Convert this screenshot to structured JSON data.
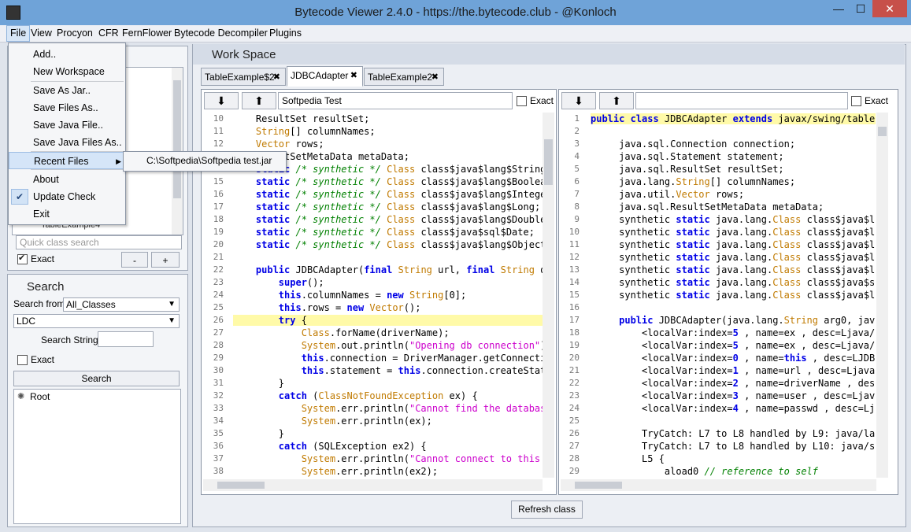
{
  "window": {
    "title": "Bytecode Viewer 2.4.0 - https://the.bytecode.club - @Konloch",
    "minimize": "—",
    "maximize": "☐",
    "close": "✕"
  },
  "menubar": [
    "File",
    "View",
    "Procyon",
    "CFR",
    "FernFlower",
    "Bytecode Decompiler",
    "Plugins"
  ],
  "file_menu": {
    "items": [
      "Add..",
      "New Workspace",
      "Save As Jar..",
      "Save Files As..",
      "Save Java File..",
      "Save Java Files As..",
      "Recent Files",
      "About",
      "Update Check",
      "Exit"
    ],
    "recent_files": [
      "C:\\Softpedia\\Softpedia test.jar"
    ]
  },
  "left_panel": {
    "tree_peek": "TableExample4",
    "quick_class_search_placeholder": "Quick class search",
    "exact_label": "Exact",
    "minus": "-",
    "plus": "+"
  },
  "search_panel": {
    "title": "Search",
    "search_from_label": "Search from",
    "search_from_value": "All_Classes",
    "mode_value": "LDC",
    "search_string_label": "Search String:",
    "search_string_value": "",
    "exact_label": "Exact",
    "search_button": "Search",
    "results_root": "Root"
  },
  "workspace": {
    "title": "Work Space",
    "tabs": [
      {
        "label": "TableExample$2",
        "close": "✖"
      },
      {
        "label": "JDBCAdapter",
        "close": "✖"
      },
      {
        "label": "TableExample2",
        "close": "✖"
      }
    ],
    "left_pane": {
      "search_value": "Softpedia Test",
      "exact_label": "Exact"
    },
    "right_pane": {
      "search_value": "",
      "exact_label": "Exact"
    },
    "refresh_button": "Refresh class"
  },
  "colors": {
    "title_bar": "#6fa3d8",
    "keyword": "#0000e6",
    "type": "#c07a00",
    "comment": "#008000",
    "string": "#cc00cc",
    "highlight_line": "#fffaa8"
  }
}
